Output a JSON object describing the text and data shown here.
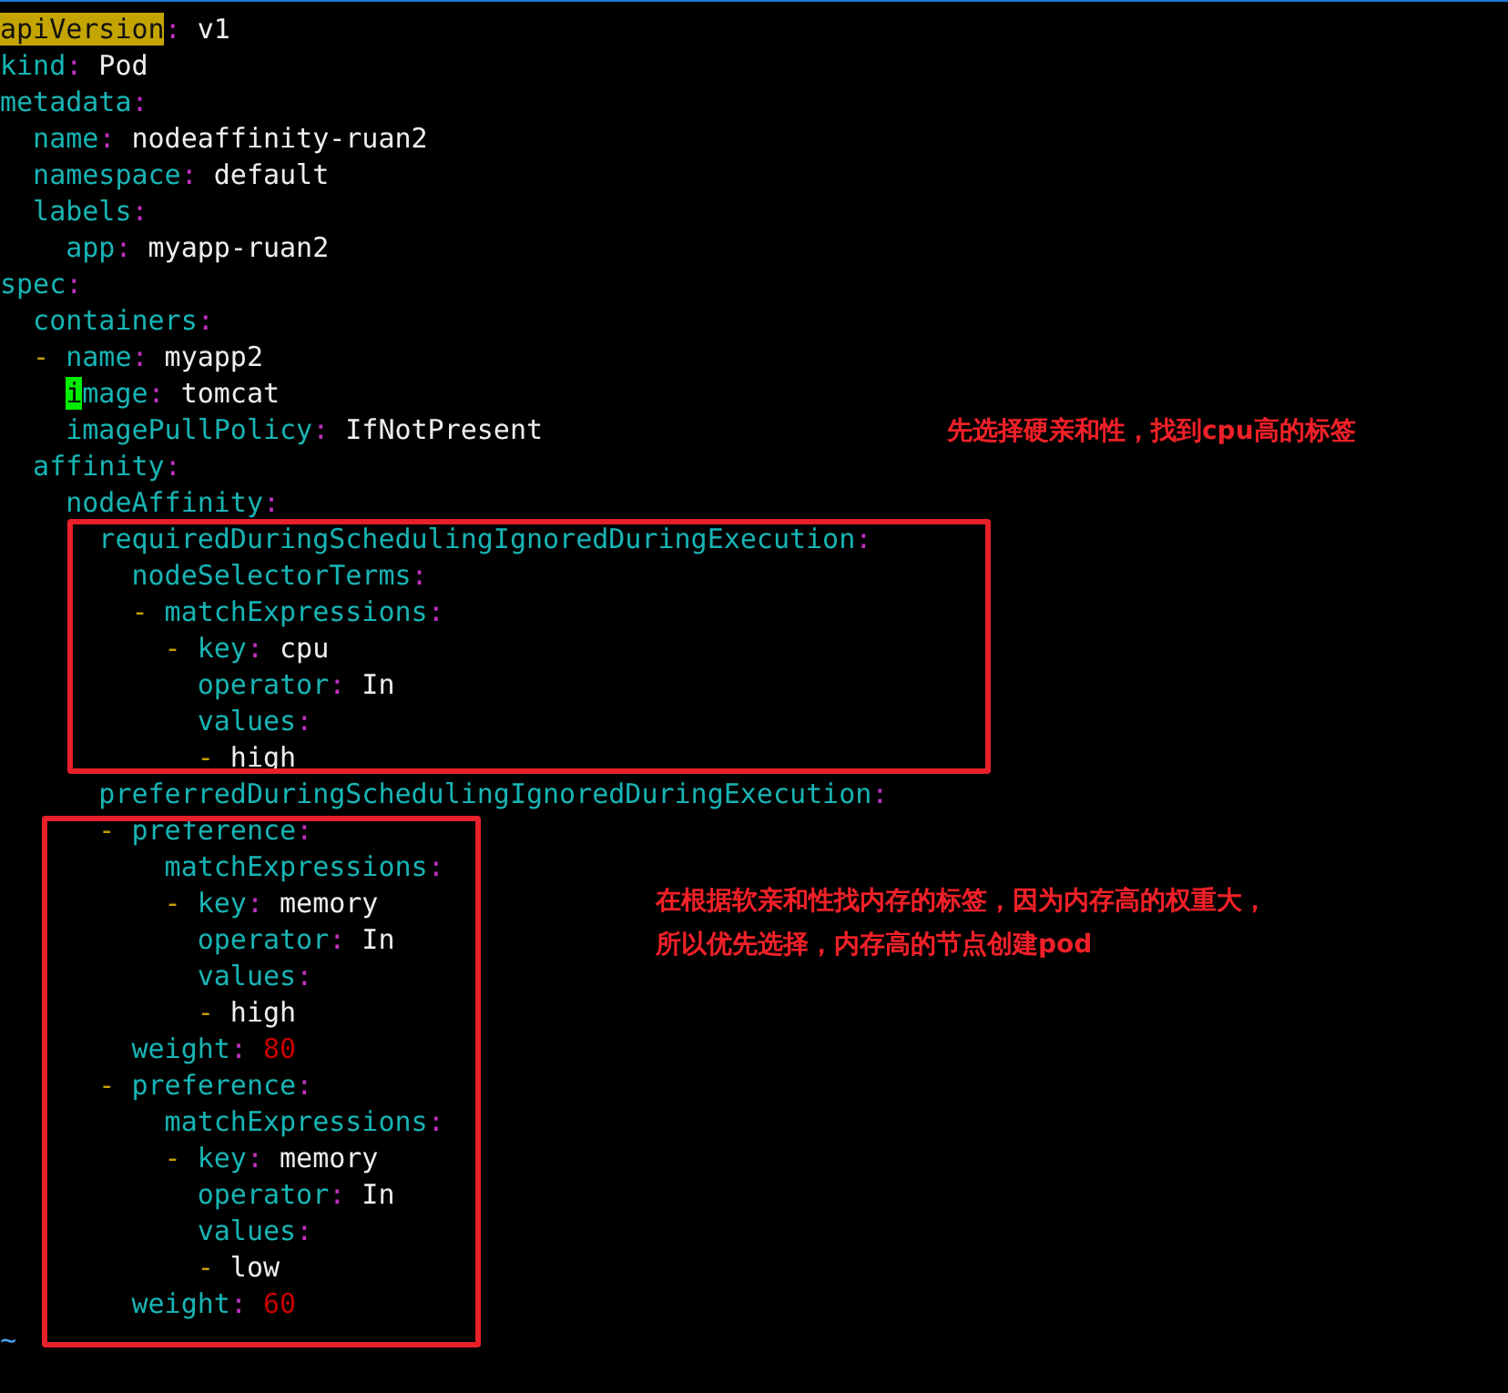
{
  "editor": {
    "lines": [
      {
        "segments": [
          {
            "kind": "match",
            "text": "apiVersion"
          },
          {
            "kind": "colon",
            "text": ":"
          },
          {
            "kind": "value",
            "text": " v1"
          }
        ]
      },
      {
        "segments": [
          {
            "kind": "key",
            "text": "kind"
          },
          {
            "kind": "colon",
            "text": ":"
          },
          {
            "kind": "value",
            "text": " Pod"
          }
        ]
      },
      {
        "segments": [
          {
            "kind": "key",
            "text": "metadata"
          },
          {
            "kind": "colon",
            "text": ":"
          }
        ]
      },
      {
        "segments": [
          {
            "kind": "key",
            "text": "  name"
          },
          {
            "kind": "colon",
            "text": ":"
          },
          {
            "kind": "value",
            "text": " nodeaffinity-ruan2"
          }
        ]
      },
      {
        "segments": [
          {
            "kind": "key",
            "text": "  namespace"
          },
          {
            "kind": "colon",
            "text": ":"
          },
          {
            "kind": "value",
            "text": " default"
          }
        ]
      },
      {
        "segments": [
          {
            "kind": "key",
            "text": "  labels"
          },
          {
            "kind": "colon",
            "text": ":"
          }
        ]
      },
      {
        "segments": [
          {
            "kind": "key",
            "text": "    app"
          },
          {
            "kind": "colon",
            "text": ":"
          },
          {
            "kind": "value",
            "text": " myapp-ruan2"
          }
        ]
      },
      {
        "segments": [
          {
            "kind": "key",
            "text": "spec"
          },
          {
            "kind": "colon",
            "text": ":"
          }
        ]
      },
      {
        "segments": [
          {
            "kind": "key",
            "text": "  containers"
          },
          {
            "kind": "colon",
            "text": ":"
          }
        ]
      },
      {
        "segments": [
          {
            "kind": "dash",
            "text": "  -"
          },
          {
            "kind": "key",
            "text": " name"
          },
          {
            "kind": "colon",
            "text": ":"
          },
          {
            "kind": "value",
            "text": " myapp2"
          }
        ]
      },
      {
        "segments": [
          {
            "kind": "cursor",
            "text": "    i"
          },
          {
            "kind": "key",
            "text": "mage"
          },
          {
            "kind": "colon",
            "text": ":"
          },
          {
            "kind": "value",
            "text": " tomcat"
          }
        ]
      },
      {
        "segments": [
          {
            "kind": "key",
            "text": "    imagePullPolicy"
          },
          {
            "kind": "colon",
            "text": ":"
          },
          {
            "kind": "value",
            "text": " IfNotPresent"
          }
        ]
      },
      {
        "segments": [
          {
            "kind": "key",
            "text": "  affinity"
          },
          {
            "kind": "colon",
            "text": ":"
          }
        ]
      },
      {
        "segments": [
          {
            "kind": "key",
            "text": "    nodeAffinity"
          },
          {
            "kind": "colon",
            "text": ":"
          }
        ]
      },
      {
        "segments": [
          {
            "kind": "key",
            "text": "      requiredDuringSchedulingIgnoredDuringExecution"
          },
          {
            "kind": "colon",
            "text": ":"
          }
        ]
      },
      {
        "segments": [
          {
            "kind": "key",
            "text": "        nodeSelectorTerms"
          },
          {
            "kind": "colon",
            "text": ":"
          }
        ]
      },
      {
        "segments": [
          {
            "kind": "dash",
            "text": "        -"
          },
          {
            "kind": "key",
            "text": " matchExpressions"
          },
          {
            "kind": "colon",
            "text": ":"
          }
        ]
      },
      {
        "segments": [
          {
            "kind": "dash",
            "text": "          -"
          },
          {
            "kind": "key",
            "text": " key"
          },
          {
            "kind": "colon",
            "text": ":"
          },
          {
            "kind": "value",
            "text": " cpu"
          }
        ]
      },
      {
        "segments": [
          {
            "kind": "key",
            "text": "            operator"
          },
          {
            "kind": "colon",
            "text": ":"
          },
          {
            "kind": "value",
            "text": " In"
          }
        ]
      },
      {
        "segments": [
          {
            "kind": "key",
            "text": "            values"
          },
          {
            "kind": "colon",
            "text": ":"
          }
        ]
      },
      {
        "segments": [
          {
            "kind": "dash",
            "text": "            -"
          },
          {
            "kind": "value",
            "text": " high"
          }
        ]
      },
      {
        "segments": [
          {
            "kind": "key",
            "text": "      preferredDuringSchedulingIgnoredDuringExecution"
          },
          {
            "kind": "colon",
            "text": ":"
          }
        ]
      },
      {
        "segments": [
          {
            "kind": "dash",
            "text": "      -"
          },
          {
            "kind": "key",
            "text": " preference"
          },
          {
            "kind": "colon",
            "text": ":"
          }
        ]
      },
      {
        "segments": [
          {
            "kind": "key",
            "text": "          matchExpressions"
          },
          {
            "kind": "colon",
            "text": ":"
          }
        ]
      },
      {
        "segments": [
          {
            "kind": "dash",
            "text": "          -"
          },
          {
            "kind": "key",
            "text": " key"
          },
          {
            "kind": "colon",
            "text": ":"
          },
          {
            "kind": "value",
            "text": " memory"
          }
        ]
      },
      {
        "segments": [
          {
            "kind": "key",
            "text": "            operator"
          },
          {
            "kind": "colon",
            "text": ":"
          },
          {
            "kind": "value",
            "text": " In"
          }
        ]
      },
      {
        "segments": [
          {
            "kind": "key",
            "text": "            values"
          },
          {
            "kind": "colon",
            "text": ":"
          }
        ]
      },
      {
        "segments": [
          {
            "kind": "dash",
            "text": "            -"
          },
          {
            "kind": "value",
            "text": " high"
          }
        ]
      },
      {
        "segments": [
          {
            "kind": "key",
            "text": "        weight"
          },
          {
            "kind": "colon",
            "text": ":"
          },
          {
            "kind": "number",
            "text": " 80"
          }
        ]
      },
      {
        "segments": [
          {
            "kind": "dash",
            "text": "      -"
          },
          {
            "kind": "key",
            "text": " preference"
          },
          {
            "kind": "colon",
            "text": ":"
          }
        ]
      },
      {
        "segments": [
          {
            "kind": "key",
            "text": "          matchExpressions"
          },
          {
            "kind": "colon",
            "text": ":"
          }
        ]
      },
      {
        "segments": [
          {
            "kind": "dash",
            "text": "          -"
          },
          {
            "kind": "key",
            "text": " key"
          },
          {
            "kind": "colon",
            "text": ":"
          },
          {
            "kind": "value",
            "text": " memory"
          }
        ]
      },
      {
        "segments": [
          {
            "kind": "key",
            "text": "            operator"
          },
          {
            "kind": "colon",
            "text": ":"
          },
          {
            "kind": "value",
            "text": " In"
          }
        ]
      },
      {
        "segments": [
          {
            "kind": "key",
            "text": "            values"
          },
          {
            "kind": "colon",
            "text": ":"
          }
        ]
      },
      {
        "segments": [
          {
            "kind": "dash",
            "text": "            -"
          },
          {
            "kind": "value",
            "text": " low"
          }
        ]
      },
      {
        "segments": [
          {
            "kind": "key",
            "text": "        weight"
          },
          {
            "kind": "colon",
            "text": ":"
          },
          {
            "kind": "number",
            "text": " 60"
          }
        ]
      }
    ],
    "tilde": "~"
  },
  "annotations": [
    {
      "lines": [
        "先选择硬亲和性，找到cpu高的标签"
      ]
    },
    {
      "lines": [
        "在根据软亲和性找内存的标签，因为内存高的权重大，",
        "所以优先选择，内存高的节点创建pod"
      ]
    }
  ]
}
